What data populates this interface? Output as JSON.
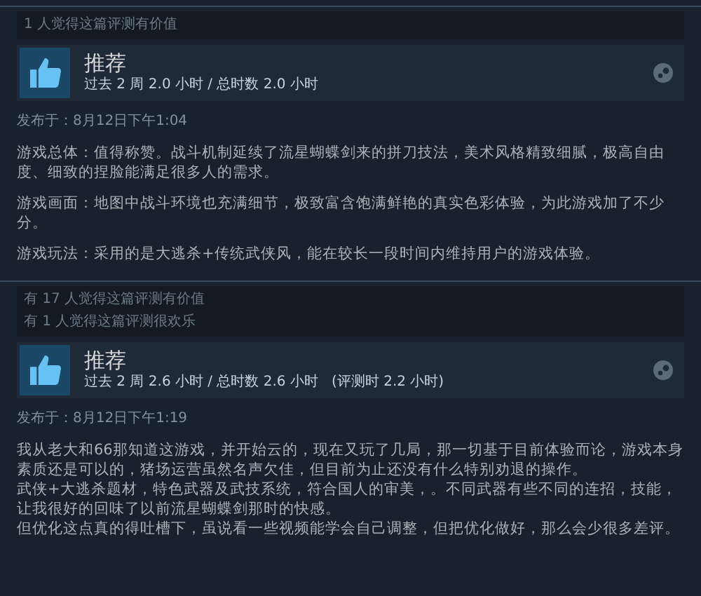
{
  "reviews": [
    {
      "helpful": [
        "1 人觉得这篇评测有价值"
      ],
      "title": "推荐",
      "hours": "过去 2 周 2.0 小时 / 总时数 2.0 小时",
      "posted": "发布于：8月12日下午1:04",
      "kind": "paragraphs",
      "body": [
        "游戏总体：值得称赞。战斗机制延续了流星蝴蝶剑来的拼刀技法，美术风格精致细腻，极高自由度、细致的捏脸能满足很多人的需求。",
        "游戏画面：地图中战斗环境也充满细节，极致富含饱满鲜艳的真实色彩体验，为此游戏加了不少分。",
        "游戏玩法：采用的是大逃杀+传统武侠风，能在较长一段时间内维持用户的游戏体验。"
      ]
    },
    {
      "helpful": [
        "有 17 人觉得这篇评测有价值",
        "有 1 人觉得这篇评测很欢乐"
      ],
      "title": "推荐",
      "hours": "过去 2 周 2.6 小时 / 总时数 2.6 小时   (评测时 2.2 小时)",
      "posted": "发布于：8月12日下午1:19",
      "kind": "lines",
      "body": [
        "我从老大和66那知道这游戏，并开始云的，现在又玩了几局，那一切基于目前体验而论，游戏本身素质还是可以的，猪场运营虽然名声欠佳，但目前为止还没有什么特别劝退的操作。",
        "武侠+大逃杀题材，特色武器及武技系统，符合国人的审美，。不同武器有些不同的连招，技能，让我很好的回味了以前流星蝴蝶剑那时的快感。",
        "但优化这点真的得吐槽下，虽说看一些视频能学会自己调整，但把优化做好，那么会少很多差评。"
      ]
    }
  ]
}
